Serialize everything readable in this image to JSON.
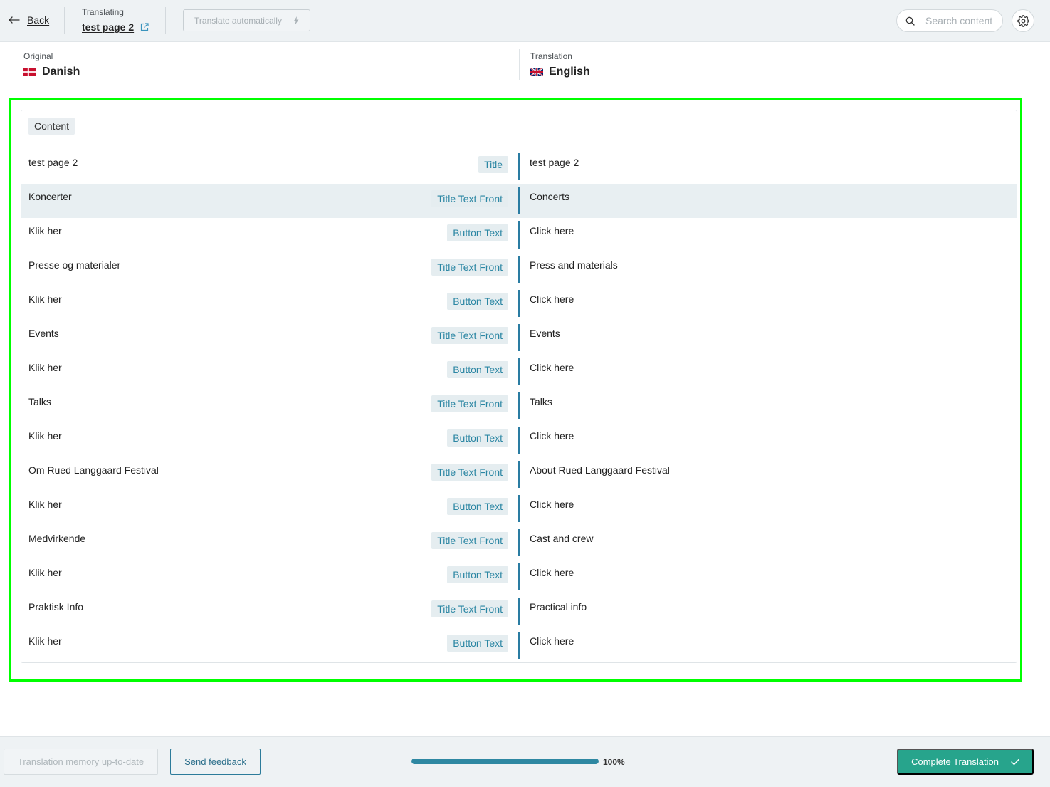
{
  "header": {
    "back_label": "Back",
    "translating_label": "Translating",
    "page_title": "test page 2",
    "translate_automatically_label": "Translate automatically",
    "search_placeholder": "Search content"
  },
  "languages": {
    "original": {
      "label": "Original",
      "name": "Danish",
      "flag_icon": "danish-flag-icon"
    },
    "translation": {
      "label": "Translation",
      "name": "English",
      "flag_icon": "uk-flag-icon"
    }
  },
  "content": {
    "section_label": "Content",
    "rows": [
      {
        "original": "test page 2",
        "field": "Title",
        "translation": "test page 2"
      },
      {
        "original": "Koncerter",
        "field": "Title Text Front",
        "translation": "Concerts",
        "selected": true
      },
      {
        "original": "Klik her",
        "field": "Button Text",
        "translation": "Click here"
      },
      {
        "original": "Presse og materialer",
        "field": "Title Text Front",
        "translation": "Press and materials"
      },
      {
        "original": "Klik her",
        "field": "Button Text",
        "translation": "Click here"
      },
      {
        "original": "Events",
        "field": "Title Text Front",
        "translation": "Events"
      },
      {
        "original": "Klik her",
        "field": "Button Text",
        "translation": "Click here"
      },
      {
        "original": "Talks",
        "field": "Title Text Front",
        "translation": "Talks"
      },
      {
        "original": "Klik her",
        "field": "Button Text",
        "translation": "Click here"
      },
      {
        "original": "Om Rued Langgaard Festival",
        "field": "Title Text Front",
        "translation": "About Rued Langgaard Festival"
      },
      {
        "original": "Klik her",
        "field": "Button Text",
        "translation": "Click here"
      },
      {
        "original": "Medvirkende",
        "field": "Title Text Front",
        "translation": "Cast and crew"
      },
      {
        "original": "Klik her",
        "field": "Button Text",
        "translation": "Click here"
      },
      {
        "original": "Praktisk Info",
        "field": "Title Text Front",
        "translation": "Practical info"
      },
      {
        "original": "Klik her",
        "field": "Button Text",
        "translation": "Click here"
      }
    ]
  },
  "footer": {
    "memory_label": "Translation memory up-to-date",
    "feedback_label": "Send feedback",
    "progress_percent": 100,
    "progress_label": "100%",
    "complete_label": "Complete Translation"
  },
  "icons": {
    "back": "arrow-left-icon",
    "page_link": "external-link-icon",
    "translate_automatically": "lightning-icon",
    "search": "search-icon",
    "settings": "gear-icon",
    "complete": "check-icon"
  },
  "colors": {
    "bar_background": "#eef2f4",
    "accent": "#2b86a3",
    "row_marker": "#2a7ca2",
    "selected_row": "#e8eff2",
    "complete_button": "#27a48c",
    "highlight_box": "#00ff00"
  }
}
